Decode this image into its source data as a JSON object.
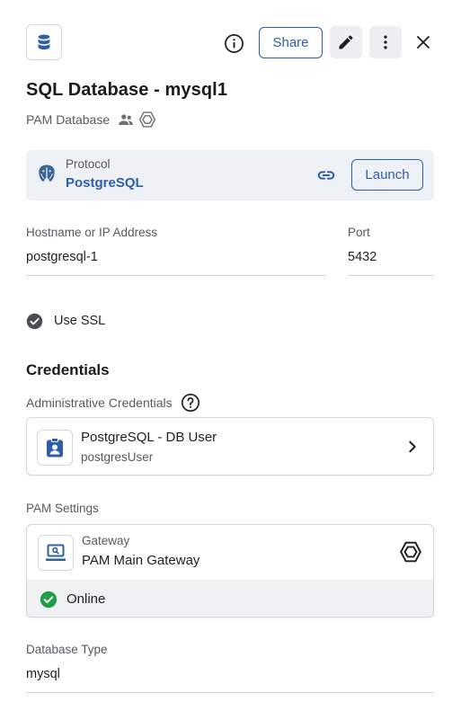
{
  "header": {
    "share_label": "Share"
  },
  "record": {
    "title": "SQL Database - mysql1",
    "type_label": "PAM Database"
  },
  "protocol": {
    "label": "Protocol",
    "value": "PostgreSQL",
    "launch_label": "Launch"
  },
  "connection": {
    "hostname_label": "Hostname or IP Address",
    "hostname_value": "postgresql-1",
    "port_label": "Port",
    "port_value": "5432",
    "ssl_label": "Use SSL",
    "ssl_checked": true
  },
  "credentials": {
    "section_title": "Credentials",
    "admin_label": "Administrative Credentials",
    "item_name": "PostgreSQL - DB User",
    "item_user": "postgresUser"
  },
  "pam_settings": {
    "label": "PAM Settings",
    "gateway_label": "Gateway",
    "gateway_name": "PAM Main Gateway",
    "status": "Online"
  },
  "database": {
    "type_label": "Database Type",
    "type_value": "mysql"
  },
  "colors": {
    "accent": "#2f5ea8",
    "online_green": "#1f9d47",
    "muted_text": "#555a61"
  },
  "icons": [
    "database-icon",
    "info-icon",
    "pencil-icon",
    "more-vertical-icon",
    "close-icon",
    "people-icon",
    "hexagon-icon",
    "postgresql-icon",
    "link-icon",
    "check-circle-icon",
    "help-icon",
    "id-badge-icon",
    "chevron-right-icon",
    "laptop-icon"
  ]
}
